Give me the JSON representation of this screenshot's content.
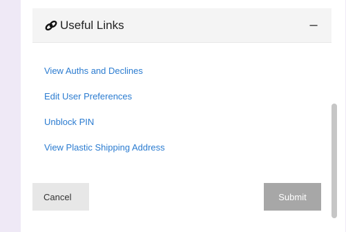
{
  "header": {
    "icon": "link-icon",
    "title": "Useful Links",
    "collapse_label": "–"
  },
  "links": [
    {
      "label": "View Auths and Declines"
    },
    {
      "label": "Edit User Preferences"
    },
    {
      "label": "Unblock PIN"
    },
    {
      "label": "View Plastic Shipping Address"
    }
  ],
  "buttons": {
    "cancel_label": "Cancel",
    "submit_label": "Submit"
  },
  "colors": {
    "background": "#efe9f6",
    "link": "#2a7bd0",
    "submit_disabled": "#a7a7a7",
    "cancel": "#e7e7e7"
  }
}
